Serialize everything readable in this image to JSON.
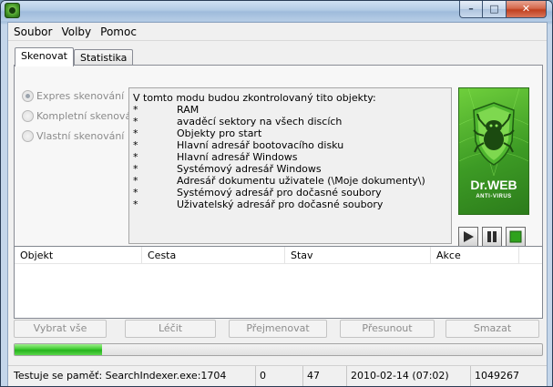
{
  "window": {
    "minimize": "–",
    "maximize": "□",
    "close": "✕",
    "app_icon": "drweb-spider-icon"
  },
  "menu": [
    "Soubor",
    "Volby",
    "Pomoc"
  ],
  "tabs": [
    "Skenovat",
    "Statistika"
  ],
  "scan_modes": [
    {
      "label": "Expres skenování",
      "selected": true
    },
    {
      "label": "Kompletní skenování",
      "selected": false
    },
    {
      "label": "Vlastní skenování",
      "selected": false
    }
  ],
  "info": {
    "title": "V tomto modu budou zkontrolovaný tito objekty:",
    "bullet": "*",
    "items": [
      "RAM",
      "avaděcí sektory na všech discích",
      "Objekty pro start",
      "Hlavní adresář bootovacího disku",
      "Hlavní adresář Windows",
      "Systémový adresář Windows",
      "Adresář dokumentu uživatele (\\Moje dokumenty\\)",
      "Systémový adresář pro dočasné soubory",
      "Uživatelský adresář pro dočasné soubory"
    ]
  },
  "logo": {
    "brand": "Dr.WEB",
    "sub": "ANTI-VIRUS"
  },
  "controls": {
    "play": "play-icon",
    "pause": "pause-icon",
    "stop": "stop-icon"
  },
  "table": {
    "columns": [
      "Objekt",
      "Cesta",
      "Stav",
      "Akce"
    ]
  },
  "buttons": {
    "select_all": "Vybrat vše",
    "cure": "Léčit",
    "rename": "Přejmenovat",
    "move": "Přesunout",
    "delete": "Smazat"
  },
  "progress": {
    "fraction": 0.165,
    "color": "#2fbf24"
  },
  "status": {
    "text": "Testuje se paměť: SearchIndexer.exe:1704",
    "c1": "0",
    "c2": "47",
    "datetime": "2010-02-14 (07:02)",
    "count": "1049267"
  }
}
